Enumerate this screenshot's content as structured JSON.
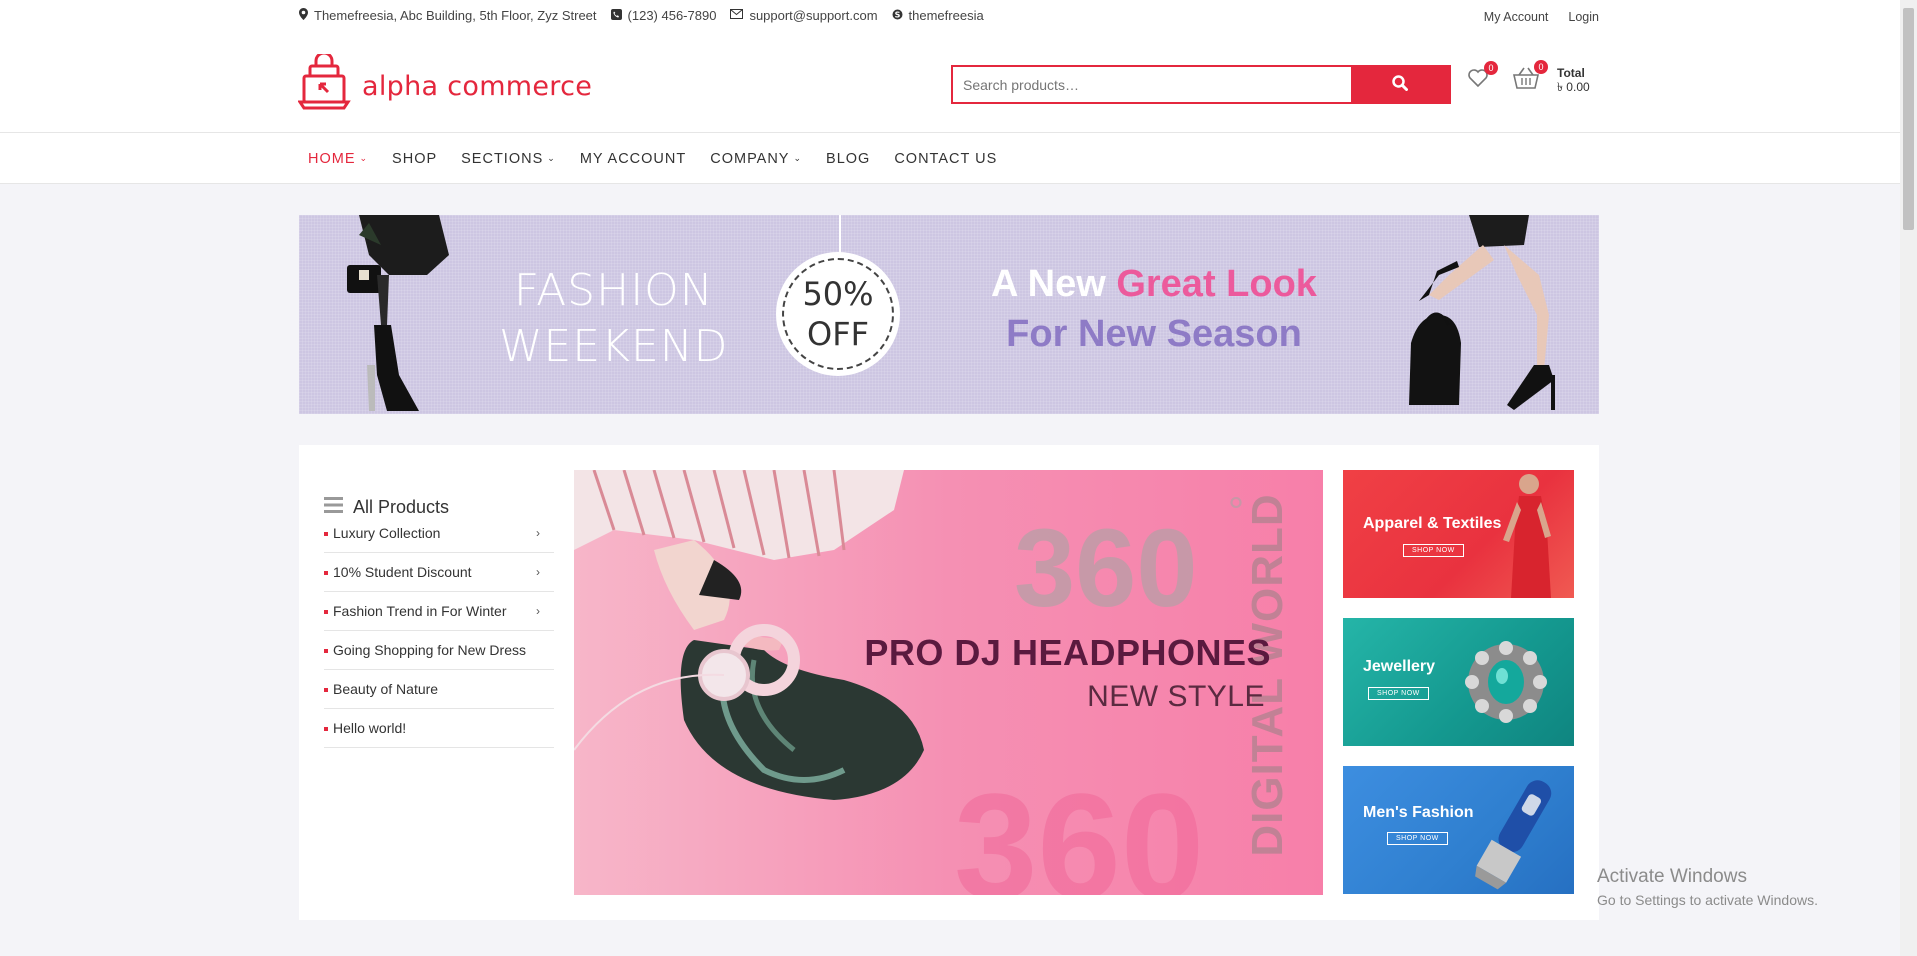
{
  "topbar": {
    "address": "Themefreesia, Abc Building, 5th Floor, Zyz Street",
    "phone": "(123) 456-7890",
    "email": "support@support.com",
    "skype": "themefreesia",
    "my_account": "My Account",
    "login": "Login"
  },
  "header": {
    "logo_text": "alpha commerce",
    "search_placeholder": "Search products…",
    "wishlist_count": "0",
    "cart_count": "0",
    "total_label": "Total",
    "total_value": "৳ 0.00"
  },
  "nav": {
    "items": [
      {
        "label": "HOME",
        "dropdown": true,
        "active": true
      },
      {
        "label": "SHOP",
        "dropdown": false
      },
      {
        "label": "SECTIONS",
        "dropdown": true
      },
      {
        "label": "MY ACCOUNT",
        "dropdown": false
      },
      {
        "label": "COMPANY",
        "dropdown": true
      },
      {
        "label": "BLOG",
        "dropdown": false
      },
      {
        "label": "CONTACT US",
        "dropdown": false
      }
    ]
  },
  "banner": {
    "line1": "FASHION",
    "line2": "WEEKEND",
    "sale_pct": "50%",
    "sale_off": "OFF",
    "headline_a": "A New ",
    "headline_pink": "Great Look",
    "headline_b": "For New Season"
  },
  "sidebar": {
    "title": "All Products",
    "items": [
      {
        "label": "Luxury Collection",
        "has_sub": true
      },
      {
        "label": "10% Student Discount",
        "has_sub": true
      },
      {
        "label": "Fashion Trend in For Winter",
        "has_sub": true
      },
      {
        "label": "Going Shopping for New Dress",
        "has_sub": false
      },
      {
        "label": "Beauty of Nature",
        "has_sub": false
      },
      {
        "label": "Hello world!",
        "has_sub": false
      }
    ]
  },
  "hero": {
    "big_number": "360",
    "degree": "°",
    "vertical_text": "DIGITAL WORLD",
    "title": "PRO DJ HEADPHONES",
    "subtitle": "NEW STYLE"
  },
  "promos": [
    {
      "title": "Apparel & Textiles",
      "button": "SHOP NOW"
    },
    {
      "title": "Jewellery",
      "button": "SHOP NOW"
    },
    {
      "title": "Men's Fashion",
      "button": "SHOP NOW"
    }
  ],
  "watermark": {
    "line1": "Activate Windows",
    "line2": "Go to Settings to activate Windows."
  },
  "colors": {
    "accent": "#e4273d",
    "banner_bg": "#cdc6e2",
    "hero_pink": "#f590b3",
    "promo_red": "#e9323f",
    "promo_teal": "#1aa59c",
    "promo_blue": "#2f7fcf"
  }
}
